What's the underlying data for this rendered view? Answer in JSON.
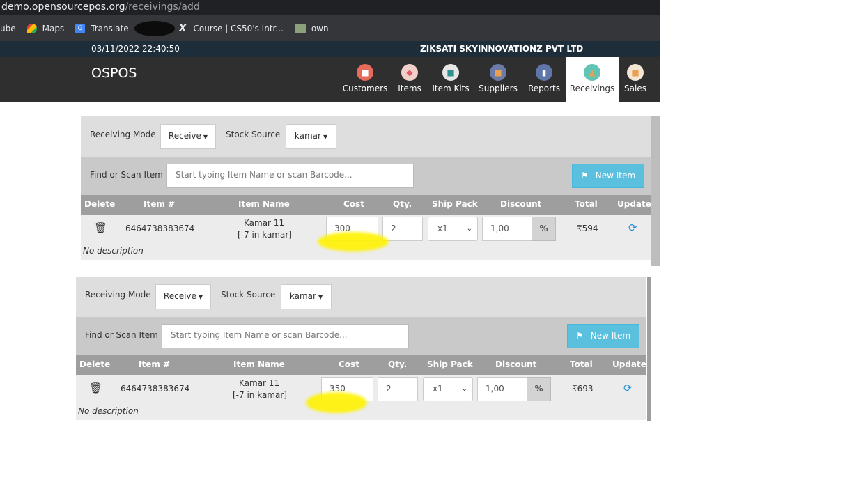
{
  "browser": {
    "url_host": "demo.opensourcepos.org",
    "url_path": "/receivings/add",
    "bookmarks": [
      {
        "label": "ube",
        "icon": "youtube-icon"
      },
      {
        "label": "Maps",
        "icon": "maps-pin-icon"
      },
      {
        "label": "Translate",
        "icon": "translate-icon"
      },
      {
        "label": "Course | CS50's Intr...",
        "icon": "x-icon"
      },
      {
        "label": "own",
        "icon": "bookmark-icon"
      }
    ]
  },
  "topbar": {
    "datetime": "03/11/2022 22:40:50",
    "company": "ZIKSATI SKYINNOVATIONZ PVT LTD"
  },
  "navbar": {
    "brand": "OSPOS",
    "items": [
      {
        "label": "Customers",
        "icon": "customers-icon",
        "color": "#e66b5b"
      },
      {
        "label": "Items",
        "icon": "items-icon",
        "color": "#e25d6b"
      },
      {
        "label": "Item Kits",
        "icon": "item-kits-icon",
        "color": "#2f8f8f"
      },
      {
        "label": "Suppliers",
        "icon": "suppliers-icon",
        "color": "#6a7ba8"
      },
      {
        "label": "Reports",
        "icon": "reports-icon",
        "color": "#5e76a8"
      },
      {
        "label": "Receivings",
        "icon": "receivings-icon",
        "color": "#62c4b5",
        "active": true
      },
      {
        "label": "Sales",
        "icon": "sales-icon",
        "color": "#e8a050"
      }
    ]
  },
  "panels": [
    {
      "receiving_mode_label": "Receiving Mode",
      "receiving_mode_value": "Receive",
      "stock_source_label": "Stock Source",
      "stock_source_value": "kamar",
      "find_label": "Find or Scan Item",
      "search_placeholder": "Start typing Item Name or scan Barcode...",
      "new_item_label": "New Item",
      "columns": [
        "Delete",
        "Item #",
        "Item Name",
        "Cost",
        "Qty.",
        "Ship Pack",
        "Discount",
        "Total",
        "Update"
      ],
      "row": {
        "item_number": "6464738383674",
        "item_name": "Kamar 11",
        "item_stock": "[-7 in kamar]",
        "cost": "300",
        "qty": "2",
        "ship_pack": "x1",
        "discount": "1,00",
        "discount_type": "%",
        "total": "₹594",
        "description": "No description"
      }
    },
    {
      "receiving_mode_label": "Receiving Mode",
      "receiving_mode_value": "Receive",
      "stock_source_label": "Stock Source",
      "stock_source_value": "kamar",
      "find_label": "Find or Scan Item",
      "search_placeholder": "Start typing Item Name or scan Barcode...",
      "new_item_label": "New Item",
      "columns": [
        "Delete",
        "Item #",
        "Item Name",
        "Cost",
        "Qty.",
        "Ship Pack",
        "Discount",
        "Total",
        "Update"
      ],
      "row": {
        "item_number": "6464738383674",
        "item_name": "Kamar 11",
        "item_stock": "[-7 in kamar]",
        "cost": "350",
        "qty": "2",
        "ship_pack": "x1",
        "discount": "1,00",
        "discount_type": "%",
        "total": "₹693",
        "description": "No description"
      }
    }
  ]
}
